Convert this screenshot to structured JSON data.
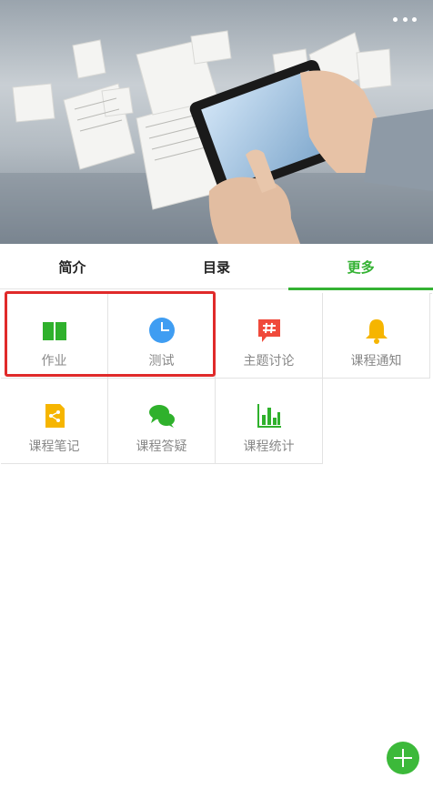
{
  "tabs": [
    {
      "label": "简介"
    },
    {
      "label": "目录"
    },
    {
      "label": "更多",
      "active": true
    }
  ],
  "features": [
    {
      "label": "作业",
      "icon": "book-icon",
      "color": "#2fb12c"
    },
    {
      "label": "测试",
      "icon": "clock-icon",
      "color": "#3f9df2"
    },
    {
      "label": "主题讨论",
      "icon": "hashtag-bubble-icon",
      "color": "#f04a3b"
    },
    {
      "label": "课程通知",
      "icon": "bell-icon",
      "color": "#f6b500"
    },
    {
      "label": "课程笔记",
      "icon": "share-note-icon",
      "color": "#f6b500"
    },
    {
      "label": "课程答疑",
      "icon": "chat-bubbles-icon",
      "color": "#2fb12c"
    },
    {
      "label": "课程统计",
      "icon": "bar-chart-icon",
      "color": "#2fb12c"
    }
  ],
  "colors": {
    "accent": "#34b233",
    "highlight": "#e02a2a",
    "fab": "#3cb93a"
  }
}
